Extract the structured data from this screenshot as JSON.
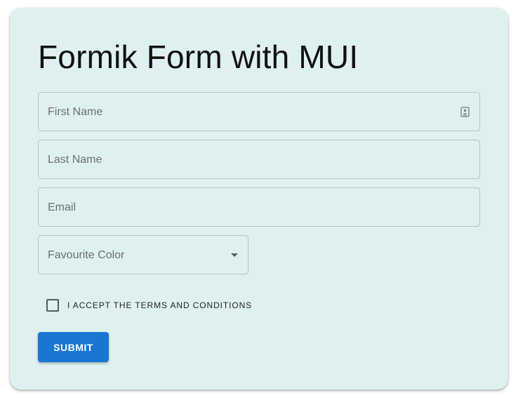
{
  "form": {
    "title": "Formik Form with MUI",
    "fields": {
      "first_name": {
        "placeholder": "First Name",
        "value": ""
      },
      "last_name": {
        "placeholder": "Last Name",
        "value": ""
      },
      "email": {
        "placeholder": "Email",
        "value": ""
      },
      "favourite_color": {
        "placeholder": "Favourite Color",
        "selected": ""
      }
    },
    "terms": {
      "label": "I ACCEPT THE TERMS AND CONDITIONS",
      "checked": false
    },
    "submit_label": "SUBMIT"
  },
  "icons": {
    "first_name_trailing": "autofill-contact-icon",
    "color_select": "dropdown-caret-icon"
  },
  "colors": {
    "card_background": "#dff0f0",
    "primary": "#1976d2",
    "outline": "#b5c3c3"
  }
}
